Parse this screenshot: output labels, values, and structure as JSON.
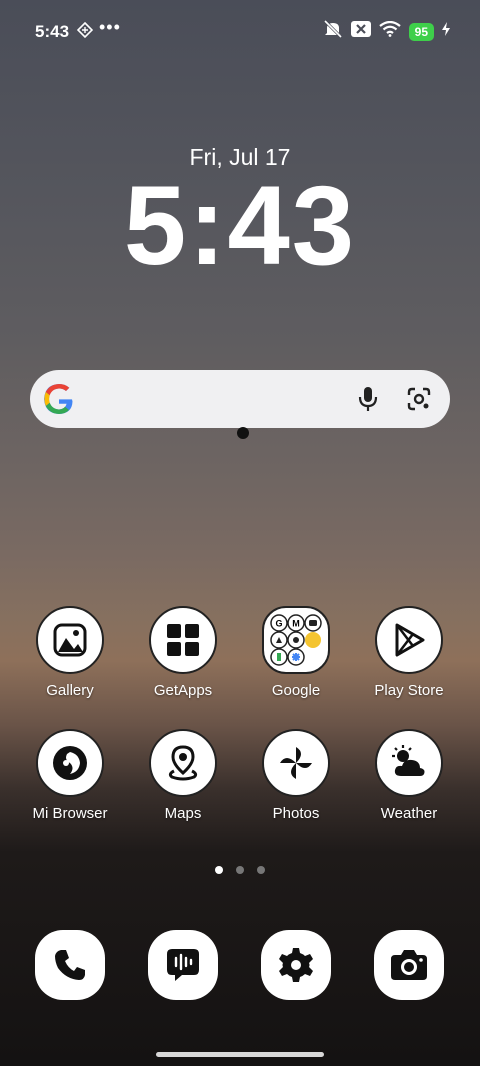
{
  "status_bar": {
    "time": "5:43",
    "battery": "95"
  },
  "lockscreen": {
    "date": "Fri, Jul 17",
    "clock": "5:43"
  },
  "apps_row1": [
    {
      "label": "Gallery"
    },
    {
      "label": "GetApps"
    },
    {
      "label": "Google"
    },
    {
      "label": "Play Store"
    }
  ],
  "apps_row2": [
    {
      "label": "Mi Browser"
    },
    {
      "label": "Maps"
    },
    {
      "label": "Photos"
    },
    {
      "label": "Weather"
    }
  ],
  "dock": [
    "phone-icon",
    "messages-icon",
    "settings-icon",
    "camera-icon"
  ],
  "colors": {
    "battery": "#3ecf4a"
  }
}
